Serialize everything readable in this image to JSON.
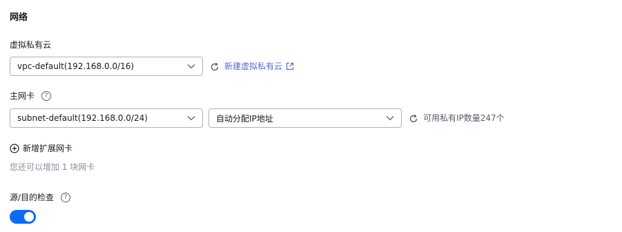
{
  "section": {
    "title": "网络"
  },
  "vpc": {
    "label": "虚拟私有云",
    "selected": "vpc-default(192.168.0.0/16)",
    "create_link": "新建虚拟私有云"
  },
  "primary_nic": {
    "label": "主网卡",
    "help_glyph": "?",
    "subnet_selected": "subnet-default(192.168.0.0/24)",
    "ip_mode_selected": "自动分配IP地址",
    "available_ip_text": "可用私有IP数量247个"
  },
  "extension_nic": {
    "add_label": "新增扩展网卡",
    "remaining_hint": "您还可以增加 1 块网卡"
  },
  "source_dest_check": {
    "label": "源/目的检查",
    "help_glyph": "?",
    "enabled": true
  },
  "colors": {
    "link": "#526ecc",
    "toggle_on": "#0d6af2",
    "border": "#adb0b8"
  }
}
